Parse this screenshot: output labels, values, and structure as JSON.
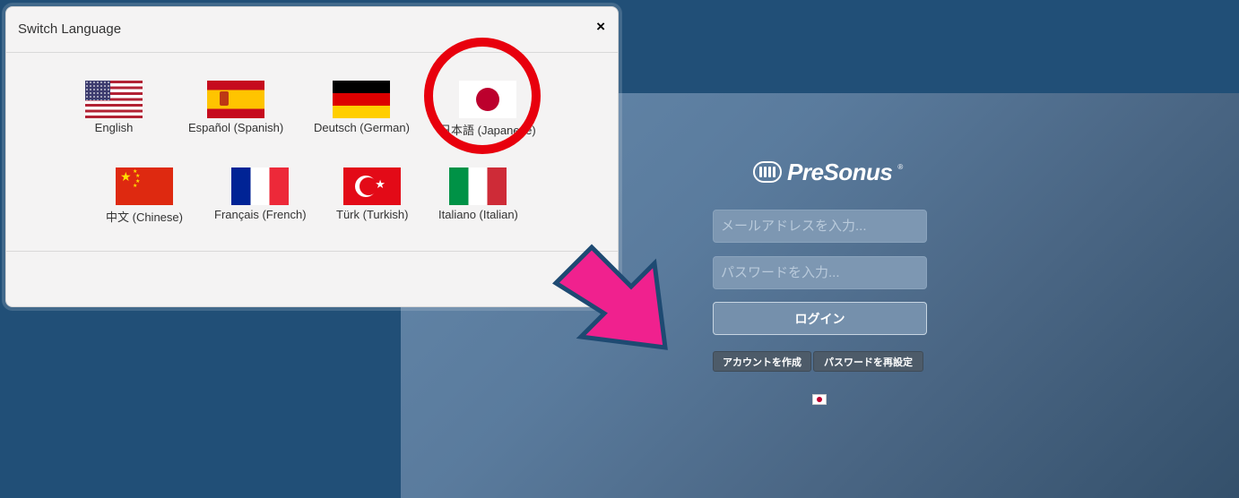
{
  "modal": {
    "title": "Switch Language",
    "close_label": "×",
    "languages": [
      {
        "label": "English",
        "flag": "us-flag-icon"
      },
      {
        "label": "Español (Spanish)",
        "flag": "spain-flag-icon"
      },
      {
        "label": "Deutsch (German)",
        "flag": "germany-flag-icon"
      },
      {
        "label": "日本語 (Japanese)",
        "flag": "japan-flag-icon"
      },
      {
        "label": "中文 (Chinese)",
        "flag": "china-flag-icon"
      },
      {
        "label": "Français (French)",
        "flag": "france-flag-icon"
      },
      {
        "label": "Türk (Turkish)",
        "flag": "turkey-flag-icon"
      },
      {
        "label": "Italiano (Italian)",
        "flag": "italy-flag-icon"
      }
    ]
  },
  "login": {
    "brand": "PreSonus",
    "brand_mark": "®",
    "email_placeholder": "メールアドレスを入力...",
    "password_placeholder": "パスワードを入力...",
    "login_button": "ログイン",
    "create_account": "アカウントを作成",
    "reset_password": "パスワードを再設定",
    "current_language_flag": "japan-flag-icon"
  },
  "annotations": {
    "circle_color": "#e8000d",
    "arrow_color": "#f0218e",
    "arrow_outline": "#1e4a72"
  }
}
